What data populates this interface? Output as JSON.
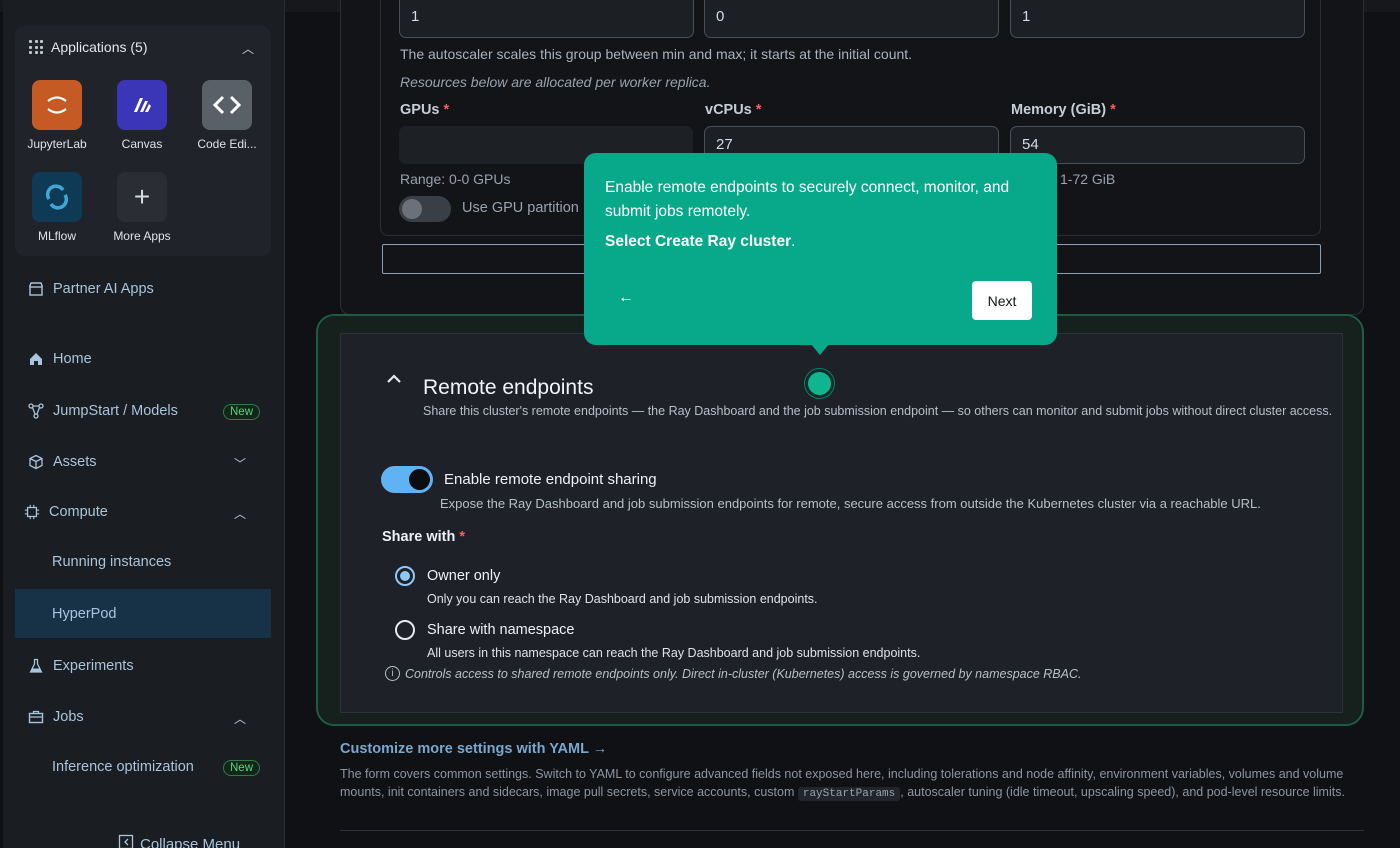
{
  "sidebar": {
    "applications_header": "Applications (5)",
    "apps": [
      {
        "label": "JupyterLab",
        "icon": "jupyter-icon",
        "color": "#c55a24"
      },
      {
        "label": "Canvas",
        "icon": "canvas-icon",
        "color": "#3b35b8"
      },
      {
        "label": "Code Edi...",
        "icon": "code-editor-icon",
        "color": "#5a6068"
      },
      {
        "label": "MLflow",
        "icon": "mlflow-icon",
        "color": "#0f3a55"
      },
      {
        "label": "More Apps",
        "icon": "plus-icon",
        "color": "#2a2d33"
      }
    ],
    "partner_apps": "Partner AI Apps",
    "nav": {
      "home": "Home",
      "jumpstart": "JumpStart / Models",
      "jumpstart_badge": "New",
      "assets": "Assets",
      "compute": "Compute",
      "running_instances": "Running instances",
      "hyperpod": "HyperPod",
      "experiments": "Experiments",
      "jobs": "Jobs",
      "inference_optimization": "Inference optimization",
      "inference_badge": "New"
    },
    "collapse_menu": "Collapse Menu"
  },
  "worker_group": {
    "min_value": "1",
    "initial_value": "0",
    "max_value": "1",
    "autoscaler_note": "The autoscaler scales this group between min and max; it starts at the initial count.",
    "resources_note": "Resources below are allocated per worker replica.",
    "gpus_label": "GPUs",
    "vcpus_label": "vCPUs",
    "memory_label": "Memory (GiB)",
    "required_mark": "*",
    "vcpus_value": "27",
    "memory_value": "54",
    "gpu_range": "Range: 0-0 GPUs",
    "memory_range": "1-72 GiB",
    "gpu_partition_label": "Use GPU partition"
  },
  "remote": {
    "title": "Remote endpoints",
    "description": "Share this cluster's remote endpoints — the Ray Dashboard and the job submission endpoint — so others can monitor and submit jobs without direct cluster access.",
    "toggle_label": "Enable remote endpoint sharing",
    "toggle_desc": "Expose the Ray Dashboard and job submission endpoints for remote, secure access from outside the Kubernetes cluster via a reachable URL.",
    "share_with_label": "Share with",
    "owner_only": "Owner only",
    "owner_only_desc": "Only you can reach the Ray Dashboard and job submission endpoints.",
    "namespace": "Share with namespace",
    "namespace_desc": "All users in this namespace can reach the Ray Dashboard and job submission endpoints.",
    "info_note": "Controls access to shared remote endpoints only. Direct in-cluster (Kubernetes) access is governed by namespace RBAC."
  },
  "yaml": {
    "link": "Customize more settings with YAML →",
    "desc_before": "The form covers common settings. Switch to YAML to configure advanced fields not exposed here, including tolerations and node affinity, environment variables, volumes and volume mounts, init containers and sidecars, image pull secrets, service accounts, custom ",
    "code": "rayStartParams",
    "desc_after": ", autoscaler tuning (idle timeout, upscaling speed), and pod-level resource limits."
  },
  "tooltip": {
    "text": "Enable remote endpoints to securely connect, monitor, and submit jobs remotely.",
    "bold": "Select Create Ray cluster",
    "period": ".",
    "back": "←",
    "next": "Next"
  },
  "colors": {
    "accent": "#08a88a",
    "link": "#7aa7cf",
    "toggle_on": "#5fb3f5",
    "required": "#ff5d64"
  }
}
